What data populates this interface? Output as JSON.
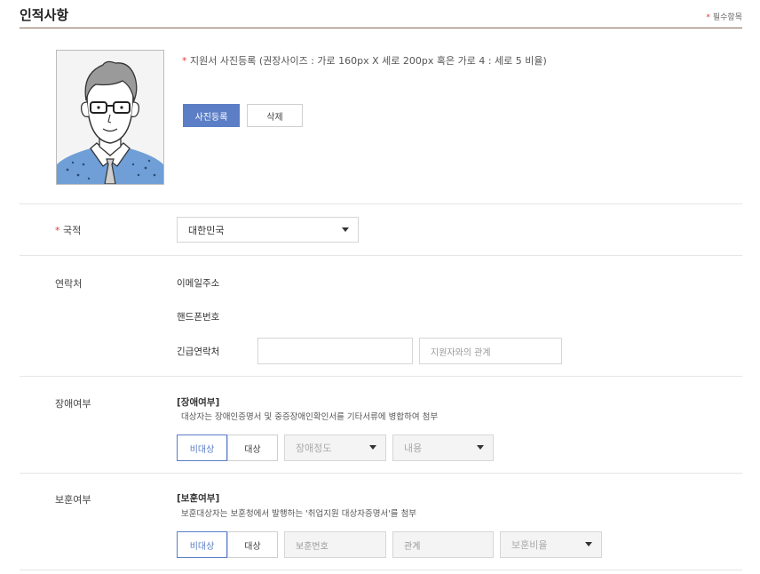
{
  "section": {
    "title": "인적사항",
    "required_mark": "*",
    "required_note": "필수항목"
  },
  "photo": {
    "required_mark": "*",
    "note": "지원서 사진등록 (권장사이즈 : 가로 160px X 세로 200px 혹은 가로 4 : 세로 5 비율)",
    "register_label": "사진등록",
    "delete_label": "삭제"
  },
  "nationality": {
    "required_mark": "*",
    "label": "국적",
    "value": "대한민국"
  },
  "contact": {
    "label": "연락처",
    "email_label": "이메일주소",
    "phone_label": "핸드폰번호",
    "emergency_label": "긴급연락처",
    "emergency_value": "",
    "relation_placeholder": "지원자와의 관계"
  },
  "disability": {
    "label": "장애여부",
    "heading": "[장애여부]",
    "desc": "대상자는 장애인증명서 및 중증장애인확인서를 기타서류에 병합하여 첨부",
    "btn_non_target": "비대상",
    "btn_target": "대상",
    "grade_placeholder": "장애정도",
    "content_placeholder": "내용"
  },
  "veteran": {
    "label": "보훈여부",
    "heading": "[보훈여부]",
    "desc": "보훈대상자는 보훈청에서 발행하는 '취업지원 대상자증명서'를 첨부",
    "btn_non_target": "비대상",
    "btn_target": "대상",
    "number_placeholder": "보훈번호",
    "relation_placeholder": "관계",
    "ratio_placeholder": "보훈비율"
  },
  "colors": {
    "primary": "#5b7ec6",
    "required": "#e03c3c",
    "title_line": "#8a6a55"
  },
  "icons": [
    "avatar-illustration",
    "dropdown-arrow-icon"
  ]
}
